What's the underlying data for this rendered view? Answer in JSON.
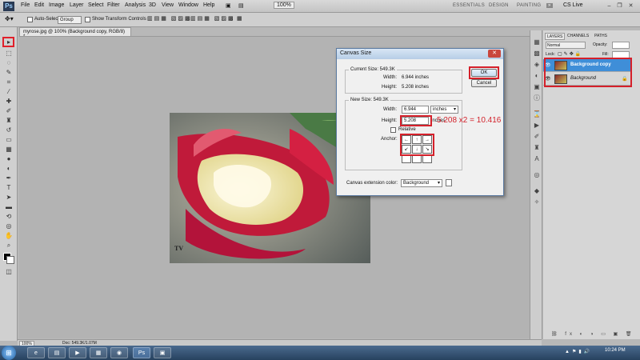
{
  "app": {
    "logo": "Ps",
    "menu": [
      "File",
      "Edit",
      "Image",
      "Layer",
      "Select",
      "Filter",
      "Analysis",
      "3D",
      "View",
      "Window",
      "Help"
    ],
    "zoom_box": "100%",
    "workspaces": [
      "ESSENTIALS",
      "DESIGN",
      "PAINTING"
    ],
    "cs_live": "CS Live"
  },
  "options_bar": {
    "auto_select_label": "Auto-Select:",
    "auto_select_value": "Group",
    "show_transform_label": "Show Transform Controls"
  },
  "document": {
    "tab_title": "myrose.jpg @ 100% (Background copy, RGB/8) *",
    "status_zoom": "100%",
    "status_doc": "Doc: 549.3K/1.07M",
    "watermark": "TV"
  },
  "dialog": {
    "title": "Canvas Size",
    "current_size_label": "Current Size: 549.3K",
    "current_width_label": "Width:",
    "current_width_value": "6.944 inches",
    "current_height_label": "Height:",
    "current_height_value": "5.208 inches",
    "new_size_label": "New Size: 549.3K",
    "width_label": "Width:",
    "width_value": "6.944",
    "width_unit": "inches",
    "height_label": "Height:",
    "height_value": "5.208",
    "height_unit": "inches",
    "relative_label": "Relative",
    "anchor_label": "Anchor:",
    "extension_label": "Canvas extension color:",
    "extension_value": "Background",
    "ok_label": "OK",
    "cancel_label": "Cancel"
  },
  "annotation": "5.208 x2 = 10.416",
  "layers_panel": {
    "tabs": [
      "LAYERS",
      "CHANNELS",
      "PATHS"
    ],
    "blend_mode": "Normal",
    "opacity_label": "Opacity:",
    "lock_label": "Lock:",
    "fill_label": "Fill:",
    "layers": [
      {
        "name": "Background copy",
        "active": true
      },
      {
        "name": "Background",
        "active": false
      }
    ]
  },
  "taskbar": {
    "clock": "10:24 PM"
  },
  "colors": {
    "highlight_red": "#d5202a",
    "layer_active": "#3f8ed8"
  }
}
